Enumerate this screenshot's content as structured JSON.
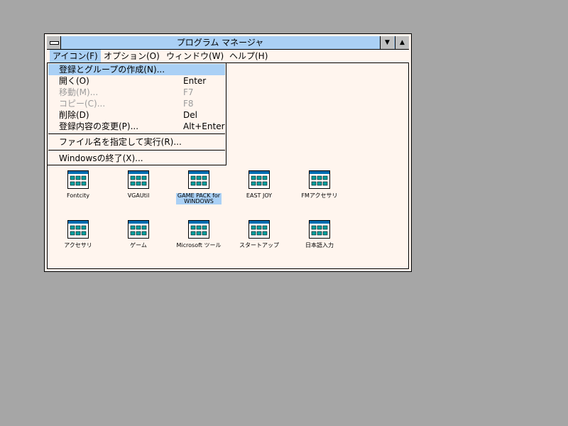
{
  "window": {
    "title": "プログラム マネージャ",
    "minimize_glyph": "▼",
    "maximize_glyph": "▲"
  },
  "menubar": {
    "items": [
      {
        "label": "アイコン(F)"
      },
      {
        "label": "オプション(O)"
      },
      {
        "label": "ウィンドウ(W)"
      },
      {
        "label": "ヘルプ(H)"
      }
    ]
  },
  "dropdown": {
    "items": [
      {
        "label": "登録とグループの作成(N)...",
        "accel": ""
      },
      {
        "label": "開く(O)",
        "accel": "Enter"
      },
      {
        "label": "移動(M)...",
        "accel": "F7"
      },
      {
        "label": "コピー(C)...",
        "accel": "F8"
      },
      {
        "label": "削除(D)",
        "accel": "Del"
      },
      {
        "label": "登録内容の変更(P)...",
        "accel": "Alt+Enter"
      },
      {
        "label": "ファイル名を指定して実行(R)...",
        "accel": ""
      },
      {
        "label": "Windowsの終了(X)...",
        "accel": ""
      }
    ]
  },
  "groups": {
    "row1": [
      {
        "label": "Fontcity"
      },
      {
        "label": "VGAUtil"
      },
      {
        "label": "GAME PACK for\nWINDOWS"
      },
      {
        "label": "EAST JOY"
      },
      {
        "label": "FMアクセサリ"
      }
    ],
    "row2": [
      {
        "label": "アクセサリ"
      },
      {
        "label": "ゲーム"
      },
      {
        "label": "Microsoft ツール"
      },
      {
        "label": "スタートアップ"
      },
      {
        "label": "日本語入力"
      }
    ]
  },
  "colors": {
    "desktop": "#a6a6a6",
    "window_bg": "#fff5ee",
    "highlight": "#aad0f5",
    "disabled_text": "#9c9c9c"
  }
}
